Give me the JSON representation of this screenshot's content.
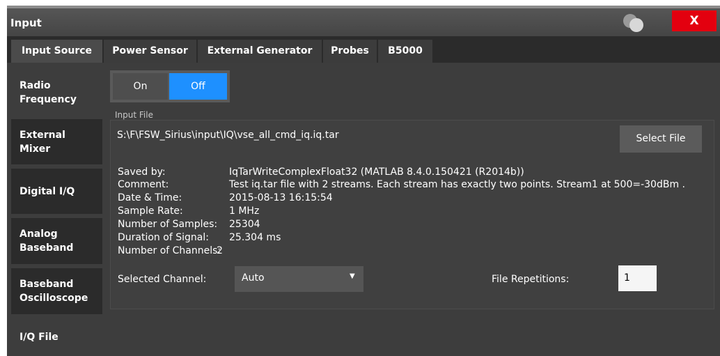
{
  "window": {
    "title": "Input",
    "close_label": "X"
  },
  "tabs": [
    "Input Source",
    "Power Sensor",
    "External Generator",
    "Probes",
    "B5000"
  ],
  "side_tabs": [
    [
      "Radio",
      "Frequency"
    ],
    [
      "External",
      "Mixer"
    ],
    [
      "Digital I/Q"
    ],
    [
      "Analog",
      "Baseband"
    ],
    [
      "Baseband",
      "Oscilloscope"
    ],
    [
      "I/Q File"
    ]
  ],
  "state": {
    "on_label": "On",
    "off_label": "Off",
    "selected": "Off"
  },
  "input_file": {
    "label": "Input File",
    "path": "S:\\F\\FSW_Sirius\\input\\IQ\\vse_all_cmd_iq.iq.tar",
    "select_button": "Select File"
  },
  "info": [
    {
      "label": "Saved by:",
      "value": "IqTarWriteComplexFloat32 (MATLAB 8.4.0.150421 (R2014b))"
    },
    {
      "label": "Comment:",
      "value": "Test iq.tar file with 2 streams. Each stream has exactly two points. Stream1 at 500=-30dBm ."
    },
    {
      "label": "Date & Time:",
      "value": "2015-08-13 16:15:54"
    },
    {
      "label": "Sample Rate:",
      "value": "1 MHz"
    },
    {
      "label": "Number of Samples:",
      "value": "25304"
    },
    {
      "label": "Duration of Signal:",
      "value": "25.304 ms"
    },
    {
      "label": "Number of Channels:",
      "value": "2"
    }
  ],
  "selected_channel": {
    "label": "Selected Channel:",
    "value": "Auto"
  },
  "file_repetitions": {
    "label": "File Repetitions:",
    "value": "1"
  },
  "colors": {
    "accent": "#1e90ff",
    "close": "#e3000f"
  }
}
